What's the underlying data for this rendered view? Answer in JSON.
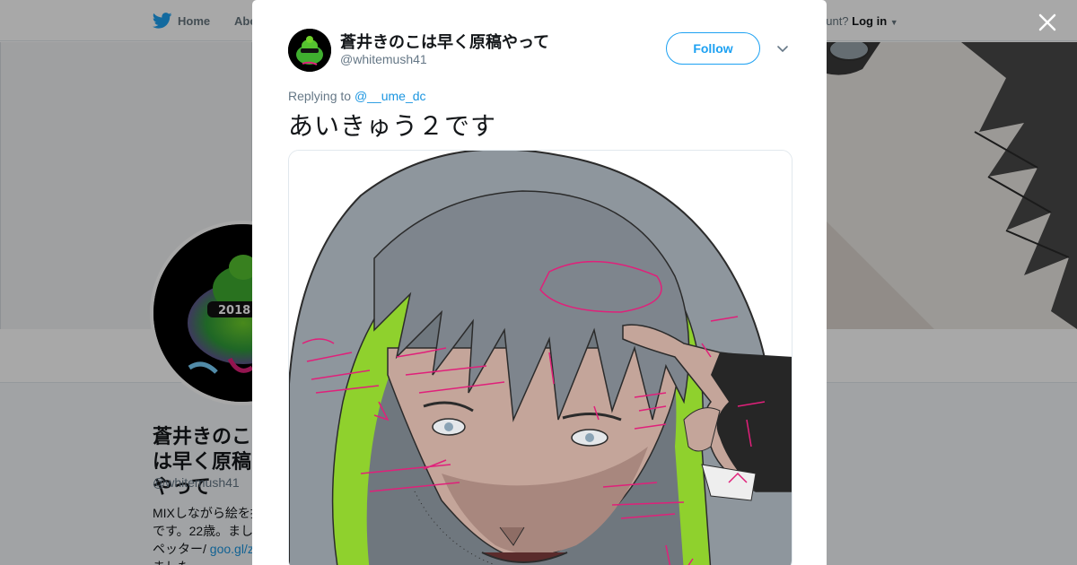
{
  "top_nav": {
    "home_label": "Home",
    "about_label": "Abo",
    "login_prompt": "ccount?",
    "login_label": "Log in"
  },
  "profile": {
    "name": "蒼井きのこは早く原稿やって",
    "handle": "@whitemush41",
    "bio_lines": [
      "MIXしながら絵を描",
      "です。22歳。まし",
      "ペッター/ ",
      "ました"
    ],
    "bio_link": "goo.gl/z",
    "avatar_text": "2018"
  },
  "tweet": {
    "author_name": "蒼井きのこは早く原稿やって",
    "author_handle": "@whitemush41",
    "follow_label": "Follow",
    "replying_prefix": "Replying to",
    "replying_to": "@__ume_dc",
    "text": "あいきゅう２です"
  },
  "colors": {
    "accent": "#1da1f2",
    "link": "#1b95e0",
    "hood": "#8e969d",
    "hood_lining": "#8fd12d",
    "annotation": "#e0207a"
  },
  "icons": {
    "logo": "twitter-bird-icon",
    "close": "close-icon",
    "caret": "chevron-down-icon"
  }
}
